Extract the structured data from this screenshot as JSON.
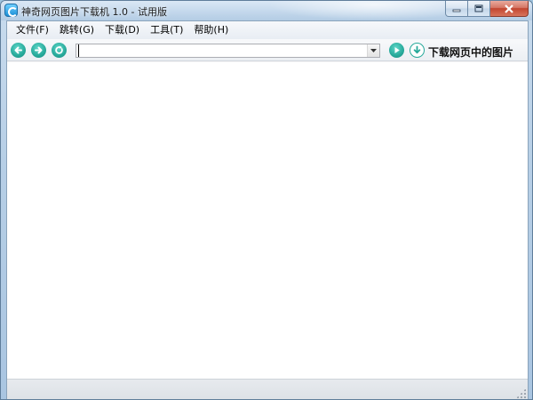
{
  "window": {
    "title": "神奇网页图片下载机 1.0 - 试用版"
  },
  "menu": {
    "items": [
      {
        "label": "文件(F)"
      },
      {
        "label": "跳转(G)"
      },
      {
        "label": "下载(D)"
      },
      {
        "label": "工具(T)"
      },
      {
        "label": "帮助(H)"
      }
    ]
  },
  "toolbar": {
    "address_value": "",
    "download_label": "下载网页中的图片",
    "icons": {
      "back": "back-arrow-icon",
      "forward": "forward-arrow-icon",
      "refresh": "refresh-icon",
      "go": "play-icon",
      "download": "download-icon"
    }
  },
  "colors": {
    "accent": "#27a99a",
    "close_button": "#c2452f",
    "content_background": "#ffffff"
  }
}
